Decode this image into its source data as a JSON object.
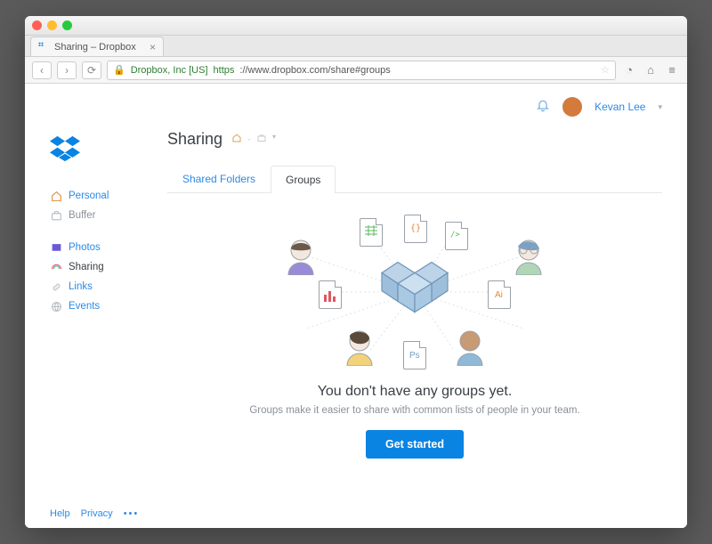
{
  "browser": {
    "tab_title": "Sharing – Dropbox",
    "url_org": "Dropbox, Inc [US]",
    "url_scheme": "https",
    "url_rest": "://www.dropbox.com/share#groups"
  },
  "header": {
    "user_name": "Kevan Lee"
  },
  "sidebar": {
    "primary": [
      {
        "label": "Personal"
      },
      {
        "label": "Buffer"
      }
    ],
    "secondary": [
      {
        "label": "Photos"
      },
      {
        "label": "Sharing"
      },
      {
        "label": "Links"
      },
      {
        "label": "Events"
      }
    ]
  },
  "page": {
    "title": "Sharing",
    "tabs": [
      {
        "label": "Shared Folders",
        "active": false
      },
      {
        "label": "Groups",
        "active": true
      }
    ],
    "empty_title": "You don't have any groups yet.",
    "empty_sub": "Groups make it easier to share with common lists of people in your team.",
    "cta_label": "Get started"
  },
  "footer": {
    "help": "Help",
    "privacy": "Privacy"
  }
}
